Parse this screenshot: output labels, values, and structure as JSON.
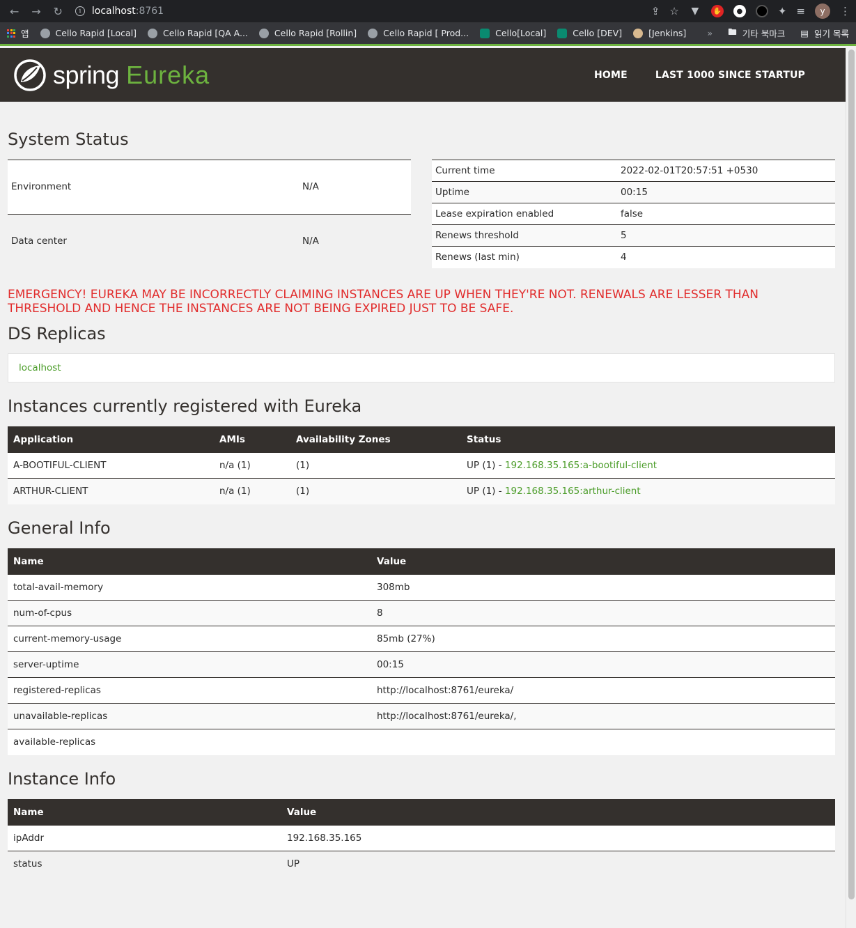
{
  "browser": {
    "url_host": "localhost",
    "url_port": ":8761",
    "avatar_letter": "y",
    "bookmarks": [
      {
        "label": "앱"
      },
      {
        "label": "Cello Rapid [Local]"
      },
      {
        "label": "Cello Rapid [QA A..."
      },
      {
        "label": "Cello Rapid [Rollin]"
      },
      {
        "label": "Cello Rapid [ Prod..."
      },
      {
        "label": "Cello[Local]"
      },
      {
        "label": "Cello [DEV]"
      },
      {
        "label": "[Jenkins]"
      }
    ],
    "more": "»",
    "other_bookmarks": "기타 북마크",
    "reading_list": "읽기 목록"
  },
  "navbar": {
    "logo_spring": "spring",
    "logo_eureka": "Eureka",
    "home": "HOME",
    "last1000": "LAST 1000 SINCE STARTUP"
  },
  "system_status": {
    "title": "System Status",
    "left": [
      {
        "name": "Environment",
        "value": "N/A"
      },
      {
        "name": "Data center",
        "value": "N/A"
      }
    ],
    "right": [
      {
        "name": "Current time",
        "value": "2022-02-01T20:57:51 +0530"
      },
      {
        "name": "Uptime",
        "value": "00:15"
      },
      {
        "name": "Lease expiration enabled",
        "value": "false"
      },
      {
        "name": "Renews threshold",
        "value": "5"
      },
      {
        "name": "Renews (last min)",
        "value": "4"
      }
    ]
  },
  "emergency": "EMERGENCY! EUREKA MAY BE INCORRECTLY CLAIMING INSTANCES ARE UP WHEN THEY'RE NOT. RENEWALS ARE LESSER THAN THRESHOLD AND HENCE THE INSTANCES ARE NOT BEING EXPIRED JUST TO BE SAFE.",
  "ds_replicas": {
    "title": "DS Replicas",
    "link": "localhost"
  },
  "instances": {
    "title": "Instances currently registered with Eureka",
    "headers": [
      "Application",
      "AMIs",
      "Availability Zones",
      "Status"
    ],
    "rows": [
      {
        "app": "A-BOOTIFUL-CLIENT",
        "amis": "n/a (1)",
        "zones": "(1)",
        "status": "UP (1) - ",
        "link": "192.168.35.165:a-bootiful-client"
      },
      {
        "app": "ARTHUR-CLIENT",
        "amis": "n/a (1)",
        "zones": "(1)",
        "status": "UP (1) - ",
        "link": "192.168.35.165:arthur-client"
      }
    ]
  },
  "general_info": {
    "title": "General Info",
    "headers": [
      "Name",
      "Value"
    ],
    "rows": [
      {
        "name": "total-avail-memory",
        "value": "308mb"
      },
      {
        "name": "num-of-cpus",
        "value": "8"
      },
      {
        "name": "current-memory-usage",
        "value": "85mb (27%)"
      },
      {
        "name": "server-uptime",
        "value": "00:15"
      },
      {
        "name": "registered-replicas",
        "value": "http://localhost:8761/eureka/"
      },
      {
        "name": "unavailable-replicas",
        "value": "http://localhost:8761/eureka/,"
      },
      {
        "name": "available-replicas",
        "value": ""
      }
    ]
  },
  "instance_info": {
    "title": "Instance Info",
    "headers": [
      "Name",
      "Value"
    ],
    "rows": [
      {
        "name": "ipAddr",
        "value": "192.168.35.165"
      },
      {
        "name": "status",
        "value": "UP"
      }
    ]
  },
  "colors": {
    "brand_green": "#6db33f",
    "navbar_bg": "#34302d",
    "emergency_red": "#e12c2c",
    "link_green": "#4c9d2a"
  }
}
